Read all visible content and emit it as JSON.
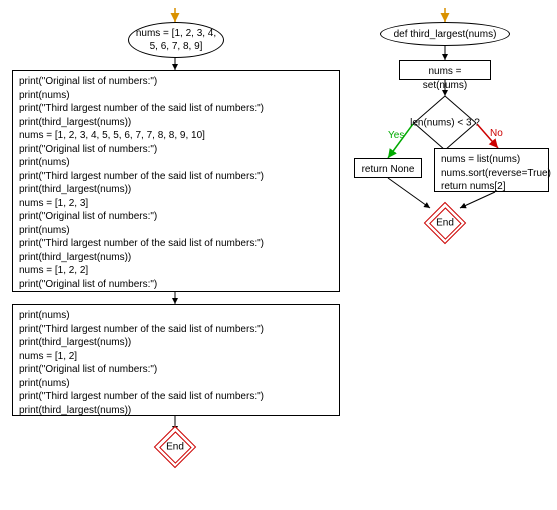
{
  "left": {
    "start_node": "nums = [1, 2, 3,\n4, 5, 6, 7, 8, 9]",
    "block1_lines": [
      "print(\"Original list of numbers:\")",
      "print(nums)",
      "print(\"Third largest number of the said list of numbers:\")",
      "print(third_largest(nums))",
      "nums = [1, 2, 3, 4, 5, 5, 6, 7, 7, 8, 8, 9, 10]",
      "print(\"Original list of numbers:\")",
      "print(nums)",
      "print(\"Third largest number of the said list of numbers:\")",
      "print(third_largest(nums))",
      "nums = [1, 2, 3]",
      "print(\"Original list of numbers:\")",
      "print(nums)",
      "print(\"Third largest number of the said list of numbers:\")",
      "print(third_largest(nums))",
      "nums = [1, 2, 2]",
      "print(\"Original list of numbers:\")"
    ],
    "block2_lines": [
      "print(nums)",
      "print(\"Third largest number of the said list of numbers:\")",
      "print(third_largest(nums))",
      "nums = [1, 2]",
      "print(\"Original list of numbers:\")",
      "print(nums)",
      "print(\"Third largest number of the said list of numbers:\")",
      "print(third_largest(nums))"
    ],
    "end_label": "End"
  },
  "right": {
    "def_node": "def third_largest(nums)",
    "set_node": "nums = set(nums)",
    "decision": "len(nums) < 3 ?",
    "yes_label": "Yes",
    "no_label": "No",
    "yes_branch": "return None",
    "no_branch_lines": [
      "nums = list(nums)",
      "nums.sort(reverse=True)",
      "return nums[2]"
    ],
    "end_label": "End"
  }
}
